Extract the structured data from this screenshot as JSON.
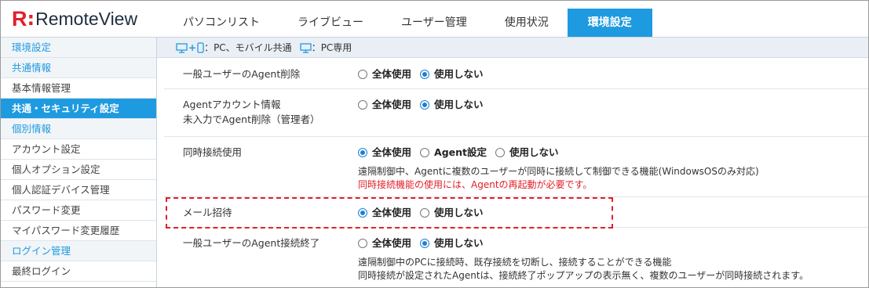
{
  "logo": {
    "r": "R",
    "colon": ":",
    "name": "RemoteView"
  },
  "tabs": [
    {
      "label": "パソコンリスト",
      "active": false
    },
    {
      "label": "ライブビュー",
      "active": false
    },
    {
      "label": "ユーザー管理",
      "active": false
    },
    {
      "label": "使用状況",
      "active": false
    },
    {
      "label": "環境設定",
      "active": true
    }
  ],
  "legend": {
    "shared": "：PC、モバイル共通",
    "pc_only": "：PC専用"
  },
  "sidebar": [
    {
      "label": "環境設定",
      "kind": "section"
    },
    {
      "label": "共通情報",
      "kind": "section"
    },
    {
      "label": "基本情報管理",
      "kind": "link"
    },
    {
      "label": "共通・セキュリティ設定",
      "kind": "active"
    },
    {
      "label": "個別情報",
      "kind": "section"
    },
    {
      "label": "アカウント設定",
      "kind": "link"
    },
    {
      "label": "個人オプション設定",
      "kind": "link"
    },
    {
      "label": "個人認証デバイス管理",
      "kind": "link"
    },
    {
      "label": "パスワード変更",
      "kind": "link"
    },
    {
      "label": "マイパスワード変更履歴",
      "kind": "link"
    },
    {
      "label": "ログイン管理",
      "kind": "section"
    },
    {
      "label": "最終ログイン",
      "kind": "link"
    }
  ],
  "settings": {
    "agent_delete": {
      "label": "一般ユーザーのAgent削除",
      "options": [
        "全体使用",
        "使用しない"
      ],
      "selected": 1
    },
    "agent_account": {
      "label1": "Agentアカウント情報",
      "label2": "未入力でAgent削除（管理者）",
      "options": [
        "全体使用",
        "使用しない"
      ],
      "selected": 1
    },
    "concurrent": {
      "label": "同時接続使用",
      "options": [
        "全体使用",
        "Agent設定",
        "使用しない"
      ],
      "selected": 0,
      "desc": "遠隔制御中、Agentに複数のユーザーが同時に接続して制御できる機能(WindowsOSのみ対応)",
      "warn": "同時接続機能の使用には、Agentの再起動が必要です。"
    },
    "mail_invite": {
      "label": "メール招待",
      "options": [
        "全体使用",
        "使用しない"
      ],
      "selected": 0
    },
    "agent_disconnect": {
      "label": "一般ユーザーのAgent接続終了",
      "options": [
        "全体使用",
        "使用しない"
      ],
      "selected": 1,
      "desc1": "遠隔制御中のPCに接続時、既存接続を切断し、接続することができる機能",
      "desc2": "同時接続が設定されたAgentは、接続終了ポップアップの表示無く、複数のユーザーが同時接続されます。"
    }
  },
  "colors": {
    "accent": "#1e9ae0",
    "brand_red": "#e0202b",
    "warn": "#e0202b"
  }
}
